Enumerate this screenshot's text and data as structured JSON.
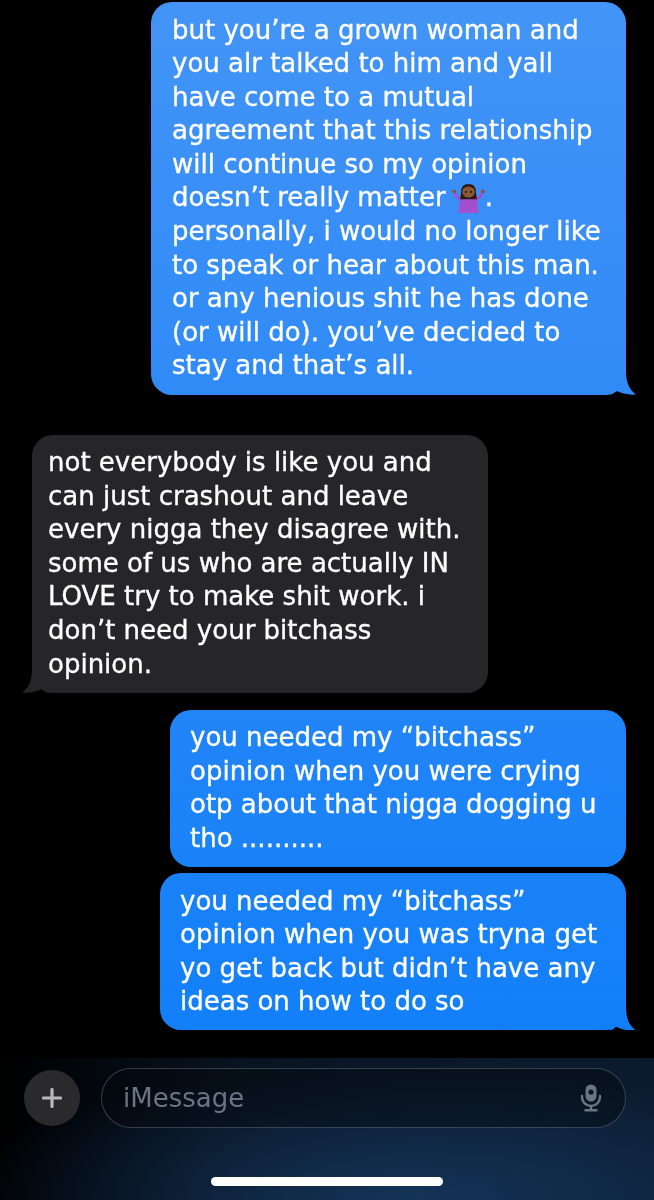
{
  "messages": [
    {
      "kind": "sent",
      "tail": true,
      "parts": [
        {
          "kind": "text",
          "text": "but you’re a grown woman and you alr talked to him and yall have come to a mutual agreement that this relationship will continue so my opinion doesn’t really matter"
        },
        {
          "kind": "emoji"
        },
        {
          "kind": "text",
          "text": ". personally, i would no longer like to speak or hear about this man. or any henious shit he has done (or will do). you’ve decided to stay and that’s all."
        }
      ]
    },
    {
      "kind": "received",
      "tail": true,
      "parts": [
        {
          "kind": "text",
          "text": "not everybody is like you and can just crashout and leave every nigga they disagree with. some of us who are actually IN LOVE try to make shit work. i don’t need your bitchass opinion."
        }
      ]
    },
    {
      "kind": "sent",
      "tail": false,
      "parts": [
        {
          "kind": "text",
          "text": "you needed my “bitchass” opinion when you were crying otp about that nigga dogging u tho .........."
        }
      ]
    },
    {
      "kind": "sent",
      "tail": true,
      "parts": [
        {
          "kind": "text",
          "text": "you needed my “bitchass” opinion when you was tryna get yo get back but didn’t have any ideas on how to do so"
        }
      ]
    }
  ],
  "compose": {
    "placeholder": "iMessage"
  }
}
